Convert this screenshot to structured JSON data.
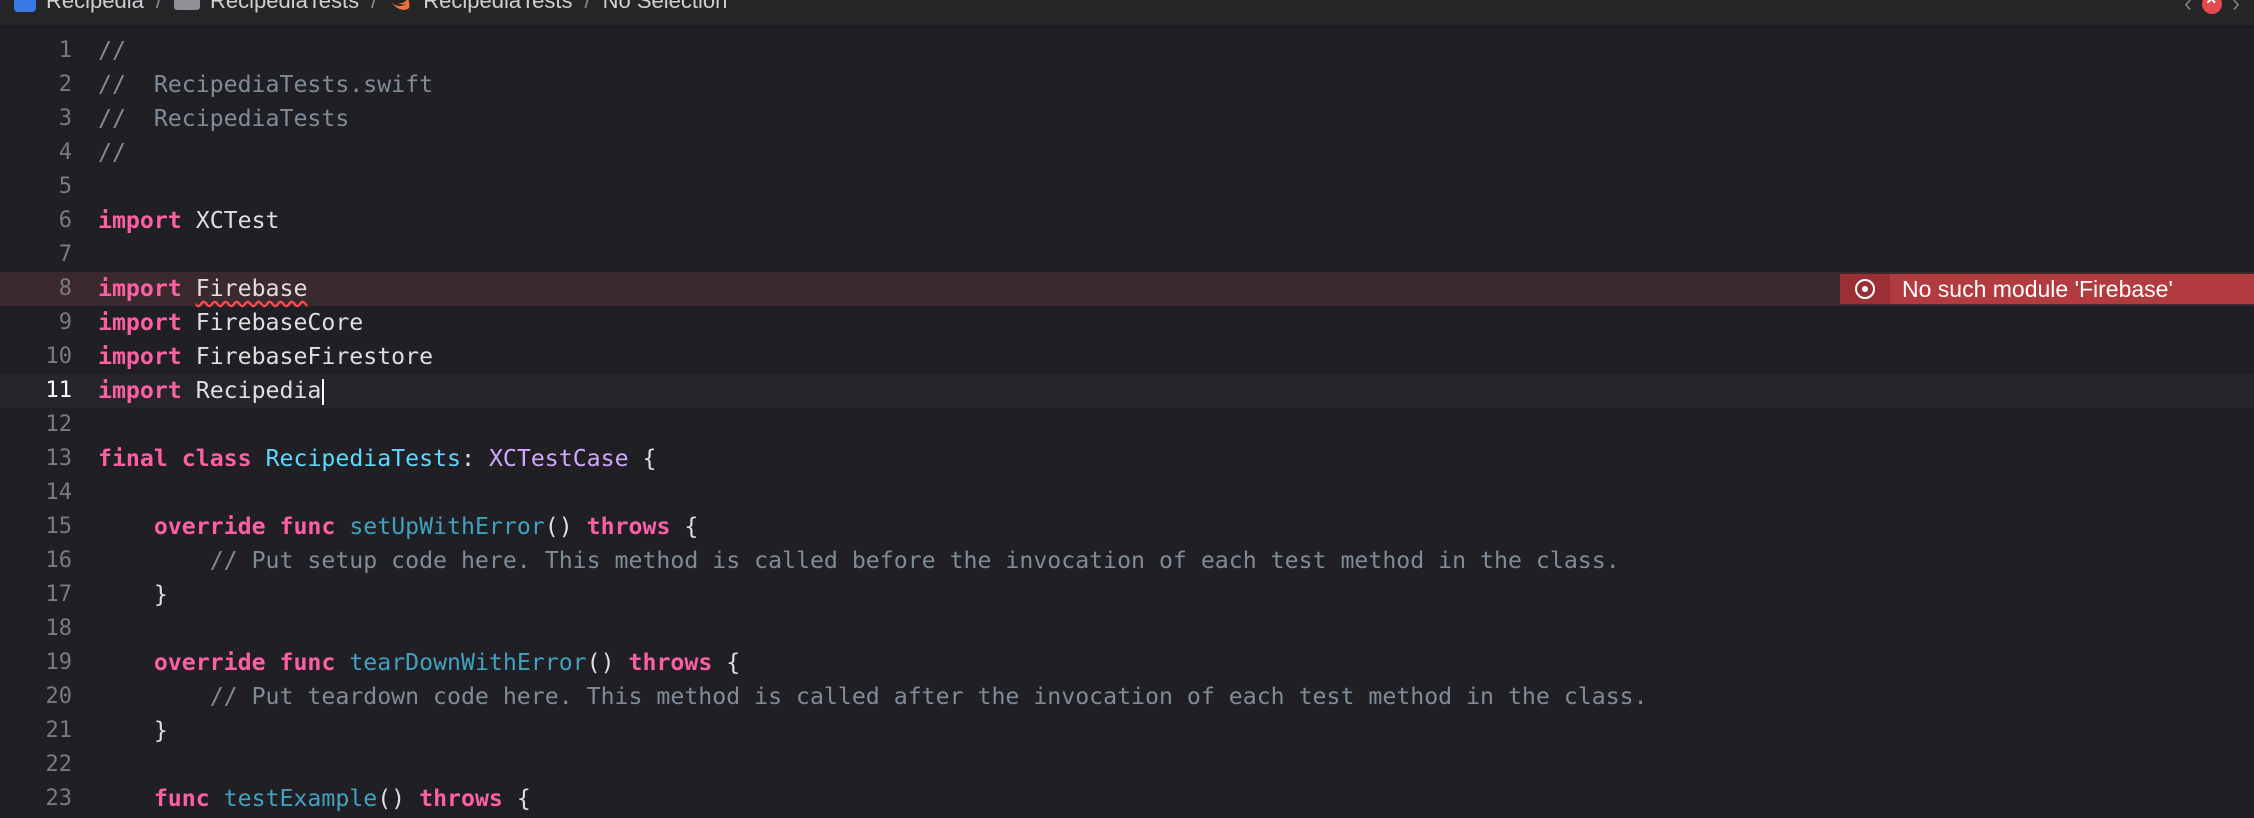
{
  "jumpbar": {
    "project": "Recipedia",
    "folder": "RecipediaTests",
    "file": "RecipediaTests",
    "selection": "No Selection"
  },
  "issue": {
    "message": "No such module 'Firebase'",
    "color": "#b23b40"
  },
  "editor": {
    "current_line": 11,
    "lines": [
      {
        "n": "1"
      },
      {
        "n": "2"
      },
      {
        "n": "3"
      },
      {
        "n": "4"
      },
      {
        "n": "5"
      },
      {
        "n": "6"
      },
      {
        "n": "7"
      },
      {
        "n": "8"
      },
      {
        "n": "9"
      },
      {
        "n": "10"
      },
      {
        "n": "11"
      },
      {
        "n": "12"
      },
      {
        "n": "13"
      },
      {
        "n": "14"
      },
      {
        "n": "15"
      },
      {
        "n": "16"
      },
      {
        "n": "17"
      },
      {
        "n": "18"
      },
      {
        "n": "19"
      },
      {
        "n": "20"
      },
      {
        "n": "21"
      },
      {
        "n": "22"
      },
      {
        "n": "23"
      }
    ],
    "code": {
      "l1": "//",
      "l2": "//  RecipediaTests.swift",
      "l3": "//  RecipediaTests",
      "l4": "//",
      "import_kw": "import",
      "l6_mod": "XCTest",
      "l8_mod": "Firebase",
      "l9_mod": "FirebaseCore",
      "l10_mod": "FirebaseFirestore",
      "l11_mod": "Recipedia",
      "final_kw": "final",
      "class_kw": "class",
      "class_name": "RecipediaTests",
      "colon": ":",
      "superclass": "XCTestCase",
      "open_brace": "{",
      "close_brace": "}",
      "override_kw": "override",
      "func_kw": "func",
      "throws_kw": "throws",
      "parens": "()",
      "setup_name": "setUpWithError",
      "setup_comment": "// Put setup code here. This method is called before the invocation of each test method in the class.",
      "teardown_name": "tearDownWithError",
      "teardown_comment": "// Put teardown code here. This method is called after the invocation of each test method in the class.",
      "example_name": "testExample"
    }
  },
  "colors": {
    "background": "#1f1f24",
    "keyword": "#fc5fa3",
    "comment": "#7f8c98",
    "type_decl": "#5dd8ff",
    "function": "#41a1c0",
    "class_ref": "#d0a8ff"
  }
}
